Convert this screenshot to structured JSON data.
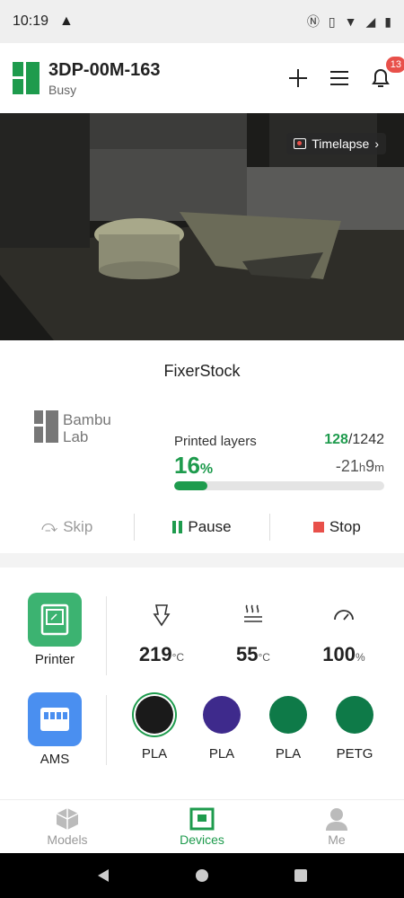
{
  "status_bar": {
    "time": "10:19",
    "warning_icon": "warning-icon"
  },
  "header": {
    "device_name": "3DP-00M-163",
    "device_status": "Busy",
    "notification_count": "13"
  },
  "camera": {
    "timelapse_label": "Timelapse"
  },
  "job": {
    "file_name": "FixerStock",
    "brand_line1": "Bambu",
    "brand_line2": "Lab",
    "layers_label": "Printed layers",
    "current_layer": "128",
    "total_layers": "/1242",
    "progress_value": "16",
    "progress_unit": "%",
    "progress_fraction": 0.16,
    "remaining_sign": "-",
    "remaining_hours": "21",
    "remaining_hours_unit": "h",
    "remaining_minutes": "9",
    "remaining_minutes_unit": "m"
  },
  "controls": {
    "skip_label": "Skip",
    "pause_label": "Pause",
    "stop_label": "Stop"
  },
  "printer": {
    "label": "Printer",
    "nozzle_temp": "219",
    "nozzle_unit": "°C",
    "bed_temp": "55",
    "bed_unit": "°C",
    "speed": "100",
    "speed_unit": "%"
  },
  "ams": {
    "label": "AMS",
    "spools": [
      {
        "material": "PLA",
        "color": "#1a1a1a"
      },
      {
        "material": "PLA",
        "color": "#3e2a8c"
      },
      {
        "material": "PLA",
        "color": "#0e7a48"
      },
      {
        "material": "PETG",
        "color": "#0e7a48"
      }
    ]
  },
  "tabs": {
    "models": "Models",
    "devices": "Devices",
    "me": "Me"
  },
  "colors": {
    "accent": "#1e9b4d",
    "alert": "#e8504a",
    "ams_tile": "#4a8ff0",
    "printer_tile": "#3cb371"
  }
}
